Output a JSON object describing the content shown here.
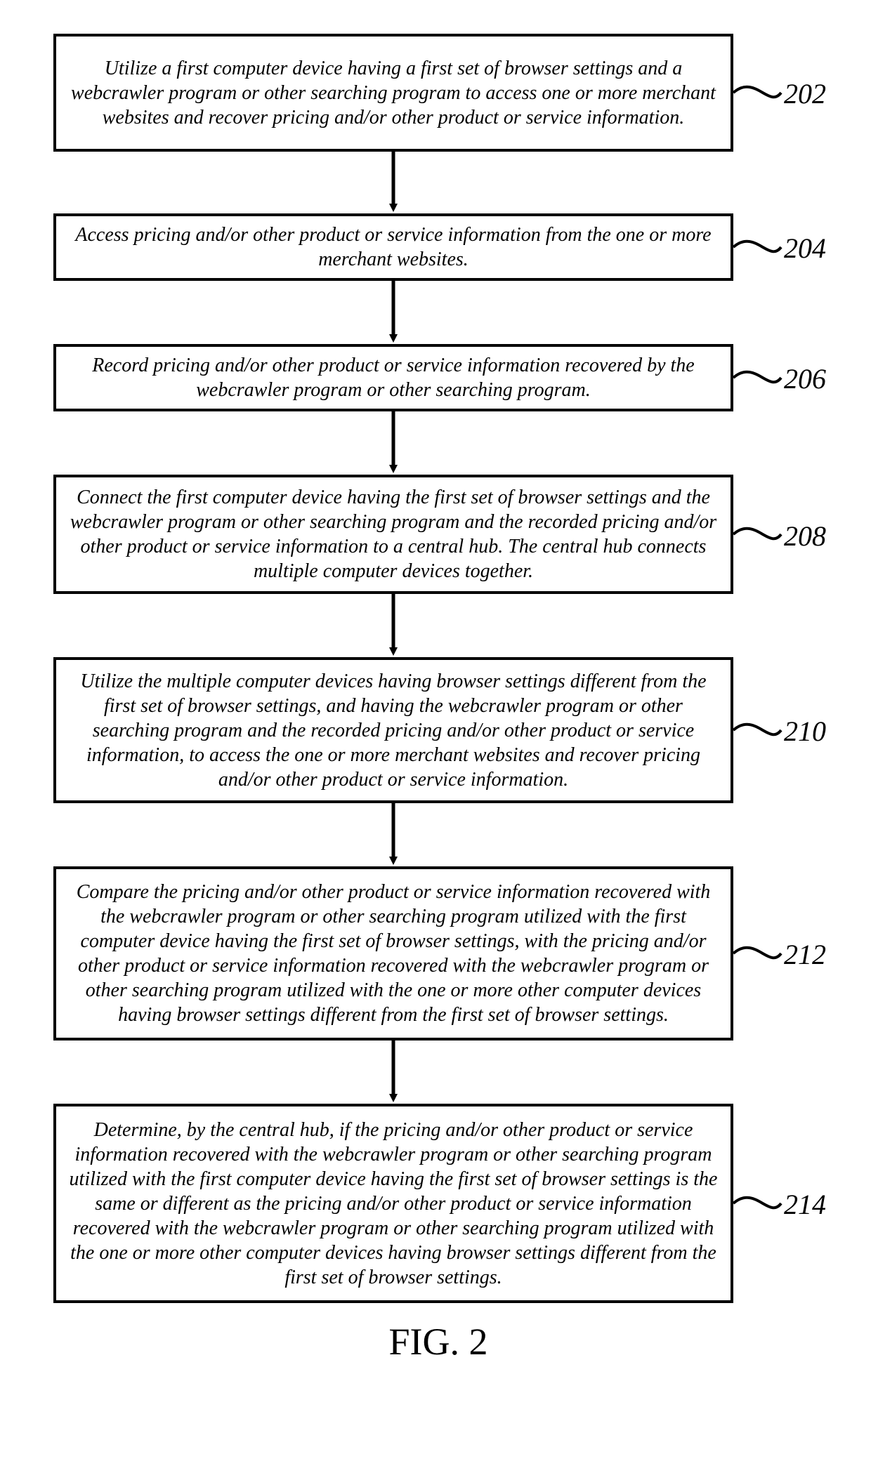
{
  "figure_title": "FIG. 2",
  "steps": [
    {
      "ref": "202",
      "text": "Utilize a first computer device having a first set of browser settings and a webcrawler program or other searching program to access one or more merchant websites and recover pricing and/or other product or service information."
    },
    {
      "ref": "204",
      "text": "Access pricing and/or other product or service information from the one or more merchant websites."
    },
    {
      "ref": "206",
      "text": "Record pricing and/or other product or service information recovered by the webcrawler program or other searching program."
    },
    {
      "ref": "208",
      "text": "Connect the first computer device having the first set of browser settings and the webcrawler program or other searching program and the recorded pricing and/or other product or service information to a central hub.  The central hub connects multiple computer devices together."
    },
    {
      "ref": "210",
      "text": "Utilize the multiple computer devices having browser settings different from the first set of browser settings, and having the webcrawler program or other searching program and the recorded pricing and/or other product or service information, to access the one or more merchant websites and recover pricing and/or other product or service information."
    },
    {
      "ref": "212",
      "text": "Compare the pricing and/or other product or service information recovered with the webcrawler program or other searching program utilized with the first computer device having the first set of browser settings, with the pricing and/or other product or service information recovered with the webcrawler program or other searching program utilized with the one or more other computer devices having browser settings different from the first set of browser settings."
    },
    {
      "ref": "214",
      "text": "Determine, by the central hub, if the pricing and/or other product or service information recovered with the webcrawler program or other searching program utilized with the first computer device having the first set of browser settings is the same or different as the pricing and/or other product or service information recovered with the webcrawler program or other searching program utilized with the one or more other computer devices having browser settings different from the first set of browser settings."
    }
  ]
}
